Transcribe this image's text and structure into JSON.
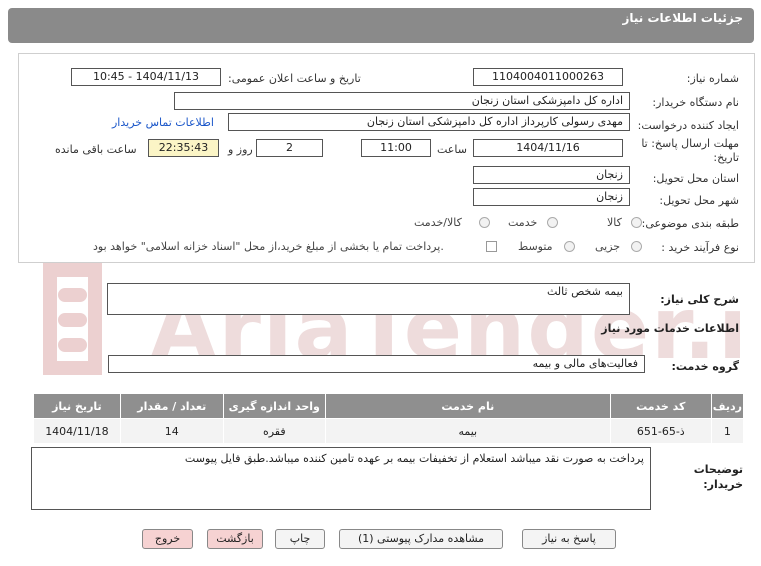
{
  "header": {
    "title": "جزئیات اطلاعات نیاز"
  },
  "form": {
    "need_number_label": "شماره نیاز:",
    "need_number": "1104004011000263",
    "announce_label": "تاریخ و ساعت اعلان عمومی:",
    "announce_value": "1404/11/13 - 10:45",
    "buyer_org_label": "نام دستگاه خریدار:",
    "buyer_org": "اداره کل دامپزشکی استان زنجان",
    "creator_label": "ایجاد کننده درخواست:",
    "creator": "مهدی رسولی کارپرداز اداره کل دامپزشکی استان زنجان",
    "contact_link": "اطلاعات تماس خریدار",
    "deadline_label_1": "مهلت ارسال پاسخ: تا",
    "deadline_label_2": "تاریخ:",
    "deadline_date": "1404/11/16",
    "time_label": "ساعت",
    "deadline_time": "11:00",
    "days_value": "2",
    "days_label": "روز و",
    "remaining_time": "22:35:43",
    "remaining_label": "ساعت باقی مانده",
    "province_label": "استان محل تحویل:",
    "province": "زنجان",
    "city_label": "شهر محل تحویل:",
    "city": "زنجان",
    "category_label": "طبقه بندی موضوعی:",
    "category_options": [
      "کالا",
      "خدمت",
      "کالا/خدمت"
    ],
    "process_label": "نوع فرآیند خرید :",
    "process_options": [
      "جزیی",
      "متوسط"
    ],
    "payment_note": "پرداخت تمام یا بخشی از مبلغ خرید،از محل \"اسناد خزانه اسلامی\" خواهد بود."
  },
  "summary": {
    "label": "شرح کلی نیاز:",
    "value": "بیمه شخص ثالث"
  },
  "services": {
    "section_title": "اطلاعات خدمات مورد نیاز",
    "group_label": "گروه خدمت:",
    "group_value": "فعالیت‌های مالی و بیمه",
    "columns": [
      "ردیف",
      "کد خدمت",
      "نام خدمت",
      "واحد اندازه گیری",
      "تعداد / مقدار",
      "تاریخ نیاز"
    ],
    "rows": [
      {
        "row": "1",
        "code": "ذ-65-651",
        "name": "بیمه",
        "unit": "فقره",
        "qty": "14",
        "date": "1404/11/18"
      }
    ]
  },
  "buyer_notes": {
    "label_1": "توضیحات",
    "label_2": "خریدار:",
    "value": "پرداخت به صورت نقد میباشد استعلام از تخفیفات بیمه بر عهده تامین کننده میباشد.طبق فایل پیوست"
  },
  "buttons": {
    "reply": "پاسخ به نیاز",
    "attachments": "مشاهده مدارک پیوستی (1)",
    "print": "چاپ",
    "back": "بازگشت",
    "exit": "خروج"
  },
  "watermark": {
    "text": "AriaTender.net"
  },
  "colors": {
    "header_bg": "#8a8a8a",
    "highlight": "#fbf5c6",
    "link": "#1a56c9",
    "pink_button": "#f6d2d2",
    "watermark": "#e8c4c4"
  }
}
